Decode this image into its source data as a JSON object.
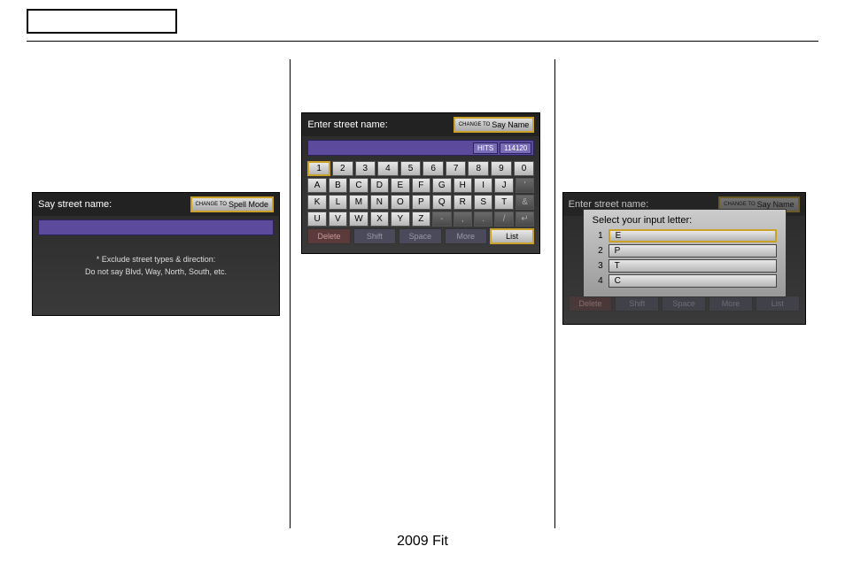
{
  "footer": "2009  Fit",
  "screen1": {
    "title": "Say street name:",
    "mode_change_small": "CHANGE TO",
    "mode_label": "Spell Mode",
    "help1": "* Exclude street types & direction:",
    "help2": "Do not say Blvd, Way, North, South, etc."
  },
  "screen2": {
    "title": "Enter street name:",
    "mode_change_small": "CHANGE TO",
    "mode_label": "Say Name",
    "hits_label": "HITS",
    "hits_value": "114120",
    "row1": [
      "1",
      "2",
      "3",
      "4",
      "5",
      "6",
      "7",
      "8",
      "9",
      "0"
    ],
    "row2": [
      "A",
      "B",
      "C",
      "D",
      "E",
      "F",
      "G",
      "H",
      "I",
      "J",
      "'"
    ],
    "row3": [
      "K",
      "L",
      "M",
      "N",
      "O",
      "P",
      "Q",
      "R",
      "S",
      "T",
      "&"
    ],
    "row4": [
      "U",
      "V",
      "W",
      "X",
      "Y",
      "Z",
      "-",
      ",",
      ".",
      "/",
      "↵"
    ],
    "fn_delete": "Delete",
    "fn_shift": "Shift",
    "fn_space": "Space",
    "fn_more": "More",
    "fn_list": "List"
  },
  "screen3": {
    "title_bg": "Enter street name:",
    "mode_change_small": "CHANGE TO",
    "mode_label": "Say Name",
    "dialog_title": "Select your input letter:",
    "options": [
      {
        "n": "1",
        "v": "E"
      },
      {
        "n": "2",
        "v": "P"
      },
      {
        "n": "3",
        "v": "T"
      },
      {
        "n": "4",
        "v": "C"
      }
    ],
    "fn_delete": "Delete",
    "fn_shift": "Shift",
    "fn_space": "Space",
    "fn_more": "More",
    "fn_list": "List"
  }
}
